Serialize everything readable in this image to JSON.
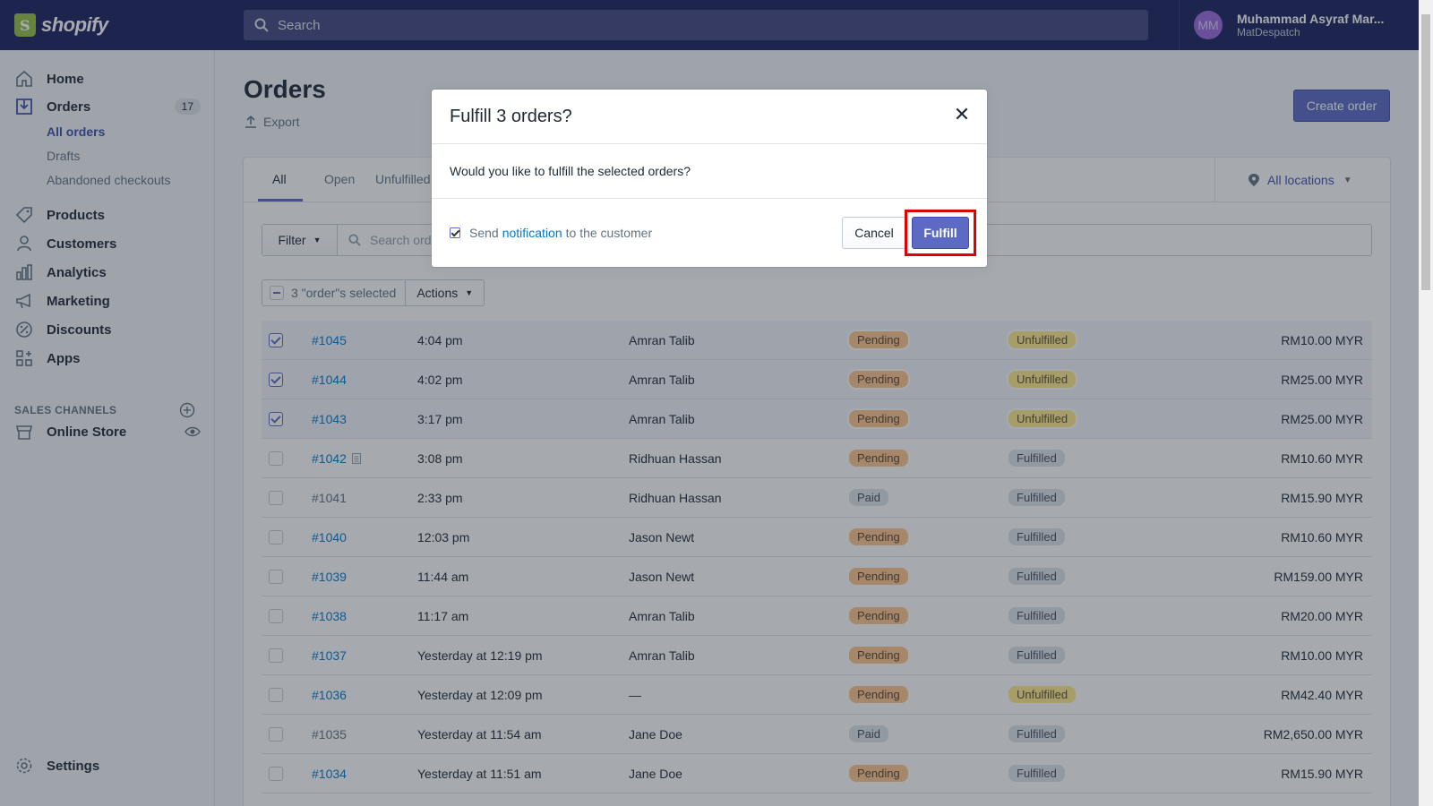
{
  "brand": {
    "name": "shopify"
  },
  "search": {
    "placeholder": "Search"
  },
  "user": {
    "initials": "MM",
    "name": "Muhammad Asyraf Mar...",
    "store": "MatDespatch"
  },
  "sidebar": {
    "items": [
      {
        "label": "Home",
        "icon": "home-icon"
      },
      {
        "label": "Orders",
        "icon": "orders-icon",
        "badge": "17"
      },
      {
        "label": "Products",
        "icon": "tag-icon"
      },
      {
        "label": "Customers",
        "icon": "person-icon"
      },
      {
        "label": "Analytics",
        "icon": "bar-chart-icon"
      },
      {
        "label": "Marketing",
        "icon": "megaphone-icon"
      },
      {
        "label": "Discounts",
        "icon": "discount-icon"
      },
      {
        "label": "Apps",
        "icon": "apps-icon"
      }
    ],
    "orders_sub": [
      "All orders",
      "Drafts",
      "Abandoned checkouts"
    ],
    "sales_channels_label": "SALES CHANNELS",
    "online_store": "Online Store",
    "settings": "Settings"
  },
  "page": {
    "title": "Orders",
    "export": "Export",
    "create_order": "Create order"
  },
  "tabs": [
    "All",
    "Open",
    "Unfulfilled"
  ],
  "locations": "All locations",
  "filter": {
    "button": "Filter",
    "search_placeholder": "Search orde"
  },
  "bulk": {
    "selected": "3 \"order\"s selected",
    "actions": "Actions"
  },
  "orders": [
    {
      "id": "#1045",
      "date": "4:04 pm",
      "customer": "Amran Talib",
      "payment": "Pending",
      "fulfillment": "Unfulfilled",
      "total": "RM10.00 MYR",
      "selected": true,
      "link": true,
      "note": false
    },
    {
      "id": "#1044",
      "date": "4:02 pm",
      "customer": "Amran Talib",
      "payment": "Pending",
      "fulfillment": "Unfulfilled",
      "total": "RM25.00 MYR",
      "selected": true,
      "link": true,
      "note": false
    },
    {
      "id": "#1043",
      "date": "3:17 pm",
      "customer": "Amran Talib",
      "payment": "Pending",
      "fulfillment": "Unfulfilled",
      "total": "RM25.00 MYR",
      "selected": true,
      "link": true,
      "note": false
    },
    {
      "id": "#1042",
      "date": "3:08 pm",
      "customer": "Ridhuan Hassan",
      "payment": "Pending",
      "fulfillment": "Fulfilled",
      "total": "RM10.60 MYR",
      "selected": false,
      "link": true,
      "note": true
    },
    {
      "id": "#1041",
      "date": "2:33 pm",
      "customer": "Ridhuan Hassan",
      "payment": "Paid",
      "fulfillment": "Fulfilled",
      "total": "RM15.90 MYR",
      "selected": false,
      "link": false,
      "note": false
    },
    {
      "id": "#1040",
      "date": "12:03 pm",
      "customer": "Jason Newt",
      "payment": "Pending",
      "fulfillment": "Fulfilled",
      "total": "RM10.60 MYR",
      "selected": false,
      "link": true,
      "note": false
    },
    {
      "id": "#1039",
      "date": "11:44 am",
      "customer": "Jason Newt",
      "payment": "Pending",
      "fulfillment": "Fulfilled",
      "total": "RM159.00 MYR",
      "selected": false,
      "link": true,
      "note": false
    },
    {
      "id": "#1038",
      "date": "11:17 am",
      "customer": "Amran Talib",
      "payment": "Pending",
      "fulfillment": "Fulfilled",
      "total": "RM20.00 MYR",
      "selected": false,
      "link": true,
      "note": false
    },
    {
      "id": "#1037",
      "date": "Yesterday at 12:19 pm",
      "customer": "Amran Talib",
      "payment": "Pending",
      "fulfillment": "Fulfilled",
      "total": "RM10.00 MYR",
      "selected": false,
      "link": true,
      "note": false
    },
    {
      "id": "#1036",
      "date": "Yesterday at 12:09 pm",
      "customer": "—",
      "payment": "Pending",
      "fulfillment": "Unfulfilled",
      "total": "RM42.40 MYR",
      "selected": false,
      "link": true,
      "note": false
    },
    {
      "id": "#1035",
      "date": "Yesterday at 11:54 am",
      "customer": "Jane Doe",
      "payment": "Paid",
      "fulfillment": "Fulfilled",
      "total": "RM2,650.00 MYR",
      "selected": false,
      "link": false,
      "note": false
    },
    {
      "id": "#1034",
      "date": "Yesterday at 11:51 am",
      "customer": "Jane Doe",
      "payment": "Pending",
      "fulfillment": "Fulfilled",
      "total": "RM15.90 MYR",
      "selected": false,
      "link": true,
      "note": false
    }
  ],
  "modal": {
    "title": "Fulfill 3 orders?",
    "body": "Would you like to fulfill the selected orders?",
    "send_prefix": "Send",
    "send_link": "notification",
    "send_suffix": "to the customer",
    "cancel": "Cancel",
    "fulfill": "Fulfill"
  },
  "colors": {
    "accent": "#5c6ac4",
    "topbar": "#1c2260",
    "highlight": "#e00000"
  }
}
